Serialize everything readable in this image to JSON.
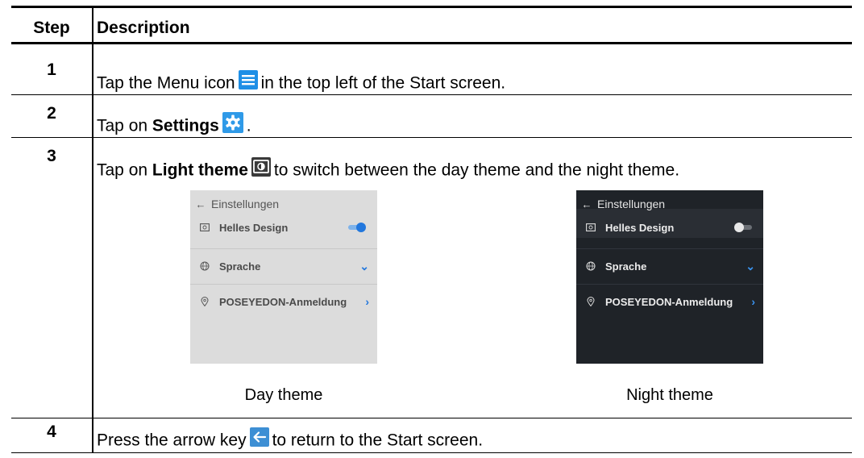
{
  "table": {
    "header_step": "Step",
    "header_description": "Description",
    "rows": [
      {
        "step": "1",
        "text_before": "Tap the Menu icon",
        "text_after": "in the top left of the Start screen."
      },
      {
        "step": "2",
        "text_before": "Tap on",
        "bold": "Settings",
        "text_after": "."
      },
      {
        "step": "3",
        "text_before": "Tap on",
        "bold": "Light theme",
        "text_after": "to switch between the day theme and the night theme."
      },
      {
        "step": "4",
        "text_before": "Press the arrow key",
        "text_after": "to return to the Start screen."
      }
    ]
  },
  "screens": {
    "day": {
      "title": "Einstellungen",
      "item1": "Helles Design",
      "item2": "Sprache",
      "item3": "POSEYEDON-Anmeldung",
      "caption": "Day theme",
      "toggle_on": true
    },
    "night": {
      "title": "Einstellungen",
      "item1": "Helles Design",
      "item2": "Sprache",
      "item3": "POSEYEDON-Anmeldung",
      "caption": "Night theme",
      "toggle_on": false
    }
  },
  "icons": {
    "menu": "menu-icon",
    "settings": "gear-icon",
    "light_theme": "theme-icon",
    "back_arrow": "back-arrow-icon"
  },
  "colors": {
    "menu_icon_bg": "#1e8fe6",
    "settings_icon_bg": "#2f9ae8",
    "back_icon_bg": "#3d8fd4",
    "accent_blue": "#2277dd"
  }
}
